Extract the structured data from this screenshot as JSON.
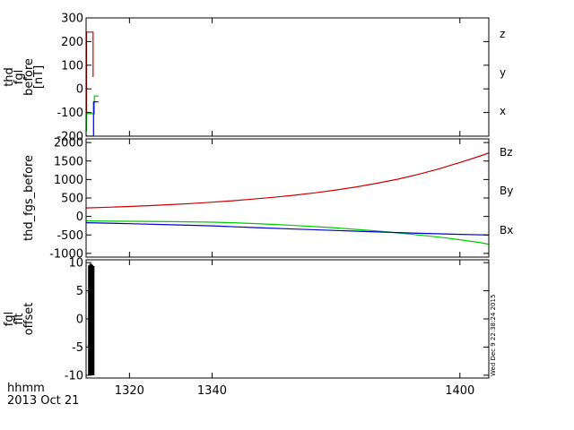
{
  "time_axis": {
    "title": "hhmm",
    "date": "2013 Oct 21",
    "range_minutes": [
      1309.5,
      1407
    ],
    "ticks": [
      1320,
      1340,
      1400
    ],
    "tick_labels": [
      "1320",
      "1340",
      "1400"
    ]
  },
  "stamp": "Wed Dec  9 22:38:24 2015",
  "chart_data": [
    {
      "type": "line",
      "ylabel_lines": [
        "thd",
        "fgl",
        "before",
        "[nT]"
      ],
      "ylim": [
        -200,
        300
      ],
      "yticks": [
        -200,
        -100,
        0,
        100,
        200,
        300
      ],
      "ytick_labels": [
        "-200",
        "-100",
        "0",
        "100",
        "200",
        "300"
      ],
      "series": [
        {
          "name": "z",
          "color": "#cc0000",
          "x": [
            1309.6,
            1309.6,
            1311.2,
            1311.2
          ],
          "y": [
            -140,
            240,
            240,
            50
          ]
        },
        {
          "name": "y",
          "color": "#00cc00",
          "x": [
            1309.6,
            1309.6,
            1311.5,
            1311.5,
            1312.5
          ],
          "y": [
            -180,
            -105,
            -105,
            -30,
            -30
          ]
        },
        {
          "name": "x",
          "color": "#0000cc",
          "x": [
            1309.6,
            1309.6,
            1311.3,
            1311.3,
            1312.5
          ],
          "y": [
            -195,
            -200,
            -200,
            -55,
            -55
          ]
        }
      ],
      "legend_labels": [
        "z",
        "y",
        "x"
      ]
    },
    {
      "type": "line",
      "ylabel_lines": [
        "thd_fgs_before"
      ],
      "ylim": [
        -1100,
        2100
      ],
      "yticks": [
        -1000,
        -500,
        0,
        500,
        1000,
        1500,
        2000
      ],
      "ytick_labels": [
        "-1000",
        "-500",
        "0",
        "500",
        "1000",
        "1500",
        "2000"
      ],
      "series": [
        {
          "name": "Bz",
          "color": "#cc0000",
          "x": [
            1309.5,
            1315,
            1320,
            1325,
            1330,
            1335,
            1340,
            1345,
            1350,
            1355,
            1360,
            1365,
            1370,
            1375,
            1380,
            1385,
            1390,
            1395,
            1400,
            1405,
            1407
          ],
          "y": [
            230,
            250,
            270,
            295,
            320,
            350,
            385,
            425,
            470,
            520,
            575,
            640,
            715,
            800,
            900,
            1010,
            1140,
            1290,
            1460,
            1640,
            1720
          ]
        },
        {
          "name": "By",
          "color": "#00cc00",
          "x": [
            1309.5,
            1320,
            1330,
            1340,
            1345,
            1350,
            1355,
            1360,
            1365,
            1370,
            1375,
            1380,
            1385,
            1390,
            1395,
            1400,
            1405,
            1407
          ],
          "y": [
            -120,
            -130,
            -140,
            -155,
            -170,
            -190,
            -215,
            -245,
            -275,
            -310,
            -350,
            -395,
            -445,
            -500,
            -560,
            -630,
            -710,
            -750
          ]
        },
        {
          "name": "Bx",
          "color": "#0000cc",
          "x": [
            1309.5,
            1315,
            1320,
            1330,
            1340,
            1350,
            1360,
            1370,
            1380,
            1390,
            1400,
            1407
          ],
          "y": [
            -170,
            -180,
            -195,
            -225,
            -255,
            -300,
            -340,
            -380,
            -420,
            -455,
            -485,
            -500
          ]
        }
      ],
      "legend_labels": [
        "Bz",
        "By",
        "Bx"
      ]
    },
    {
      "type": "bar",
      "ylabel_lines": [
        "fgl",
        "flt",
        "offset"
      ],
      "ylim": [
        -10.5,
        10.5
      ],
      "yticks": [
        -10,
        -5,
        0,
        5,
        10
      ],
      "ytick_labels": [
        "-10",
        "-5",
        "0",
        "5",
        "10"
      ],
      "series": [
        {
          "name": "",
          "color": "#000000",
          "x": [
            1310.3,
            1310.6,
            1310.9,
            1311.2
          ],
          "y_low": [
            -10,
            -10,
            -10,
            -10
          ],
          "y_high": [
            9.5,
            9.8,
            9.6,
            9.4
          ]
        }
      ],
      "legend_labels": []
    }
  ]
}
